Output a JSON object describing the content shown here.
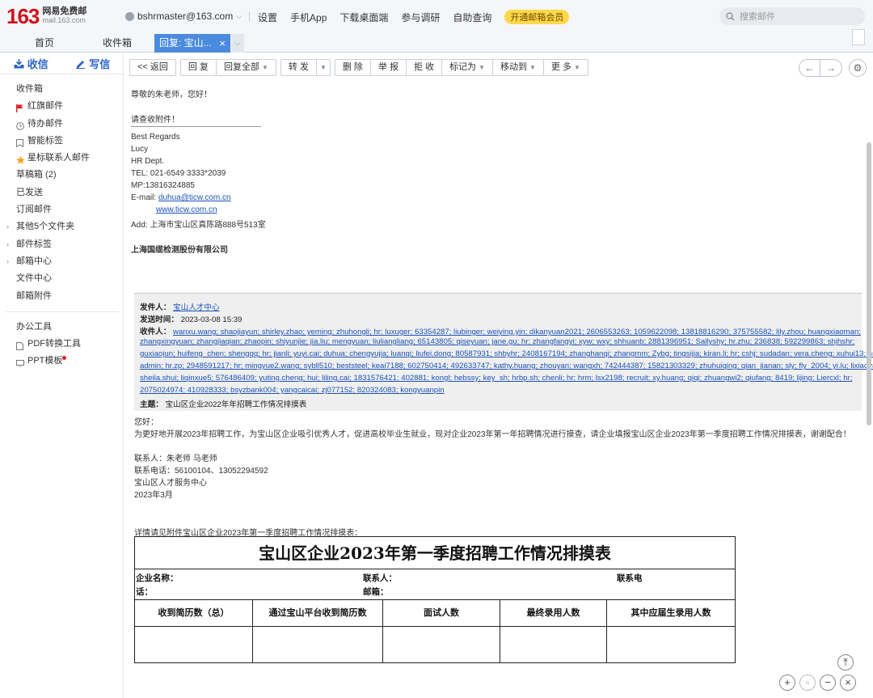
{
  "header": {
    "logo_num": "163",
    "logo_cn": "网易免费邮",
    "logo_domain": "mail.163.com",
    "user": "bshrmaster@163.com",
    "nav": [
      "设置",
      "手机App",
      "下载桌面端",
      "参与调研",
      "自助查询"
    ],
    "vip": "开通邮箱会员",
    "search_placeholder": "搜索邮件"
  },
  "tabs": {
    "home": "首页",
    "inbox": "收件箱",
    "active": "回复: 宝山...",
    "close": "×"
  },
  "sidebar": {
    "receive": "收信",
    "compose": "写信",
    "items": [
      {
        "label": "收件箱"
      },
      {
        "label": "红旗邮件"
      },
      {
        "label": "待办邮件"
      },
      {
        "label": "智能标签"
      },
      {
        "label": "星标联系人邮件"
      },
      {
        "label": "草稿箱 (2)"
      },
      {
        "label": "已发送"
      },
      {
        "label": "订阅邮件"
      },
      {
        "label": "其他5个文件夹"
      },
      {
        "label": "邮件标签"
      },
      {
        "label": "邮箱中心"
      },
      {
        "label": "文件中心"
      },
      {
        "label": "邮箱附件"
      }
    ],
    "tools_title": "办公工具",
    "tools": [
      "PDF转换工具",
      "PPT模板"
    ]
  },
  "toolbar": {
    "back": "<< 返回",
    "reply": "回 复",
    "reply_all": "回复全部",
    "forward": "转 发",
    "delete": "删 除",
    "report": "举 报",
    "reject": "拒 收",
    "mark": "标记为",
    "move": "移动到",
    "more": "更 多"
  },
  "mail": {
    "greeting": "尊敬的朱老师，您好！",
    "body": "请查收附件！",
    "sig": [
      "Best Regards",
      "Lucy",
      "HR Dept.",
      "TEL: 021-6549 3333*2039",
      "MP:13816324885"
    ],
    "email_label": "E-mail:",
    "email": "duhua@ticw.com.cn",
    "website": "www.ticw.com.cn",
    "address": "Add: 上海市宝山区真陈路888号513室",
    "company": "上海国缆检测股份有限公司"
  },
  "quoted": {
    "from_label": "发件人：",
    "from": "宝山人才中心",
    "time_label": "发送时间：",
    "time": "2023-03-08 15:39",
    "to_label": "收件人：",
    "to_lines": [
      "wanxu.wang; shaojiayun; shirley.zhao; yeming; zhuhongli; hr; luxuger; 63354287; liubinger; weiying.yin; dikanyuan2021; 2606553263; 1059622098; 13818816290; 375755582; lily.zhou; huangxiaoman;",
      "zhangxingyuan; zhangjiaqian; zhaopin; shiyunjie; jia.liu; mengyuan; liuliangliang; 65143805; qiseyuan; jane.gu; hr; zhangfangyi; xyw; wxy; shhuanb; 2881396951; Sallyshy; hr.zhu; 236838; 592299863; shjhshr;",
      "guxiaojun; huifeng_chen; shengqq; hr; jianli; yuyi.cai; duhua; chengyujia; luanqi; liufei.dong; 80587931; shbyhr; 2408167194; zhanghanqi; zhangmm; Zybg; tingsijia; kiran.li; hr; cshj; sudadan; vera.cheng; xuhui13; hr;",
      "admin; hr.zp; 2948591217; hr; mingyue2.wang; sybll510; beststeel; keai7188; 602750414; 492633747; kathy.huang; zhouyan; wangxh; 742444387; 15821303329; zhuhuiqing; qian_jianan; sly; fly_2004; yi.lu; lixiaoyan;",
      "sheila.shui; liqinxue5; 576486409; yuting.cheng; hui; liling.cai; 1831576421; 402881; kongl; hebssy; key_sh; hrbp.sh; chenli; hr; hrm; lsx2198; recruit; xy.huang; qiqi; zhuangwi2; qiufang; 8419; lijing; Liercxl; hr;",
      "2075024974; 410928333; bsyzbank004; yangcaicai; zj077152; 820324083; kongyuanpin"
    ],
    "subject_label": "主题：",
    "subject": "宝山区企业2022年年招聘工作情况排摸表"
  },
  "notice": {
    "hello": "您好：",
    "para": "为更好地开展2023年招聘工作，为宝山区企业吸引优秀人才，促进高校毕业生就业，现对企业2023年第一年招聘情况进行摸查，请企业填报宝山区企业2023年第一季度招聘工作情况排摸表，谢谢配合！",
    "contact": "联系人：朱老师 马老师",
    "phone": "联系电话：56100104、13052294592",
    "org": "宝山区人才服务中心",
    "date": "2023年3月",
    "detail": "详情请见附件宝山区企业2023年第一季度招聘工作情况排摸表："
  },
  "form": {
    "title": "宝山区企业2023年第一季度招聘工作情况排摸表",
    "company_label": "企业名称：",
    "contact_label": "联系人：",
    "phone_label_a": "联系电",
    "phone_label_b": "话：",
    "email_label": "邮箱：",
    "columns": [
      "收到简历数（总）",
      "通过宝山平台收到简历数",
      "面试人数",
      "最终录用人数",
      "其中应届生录用人数"
    ]
  }
}
